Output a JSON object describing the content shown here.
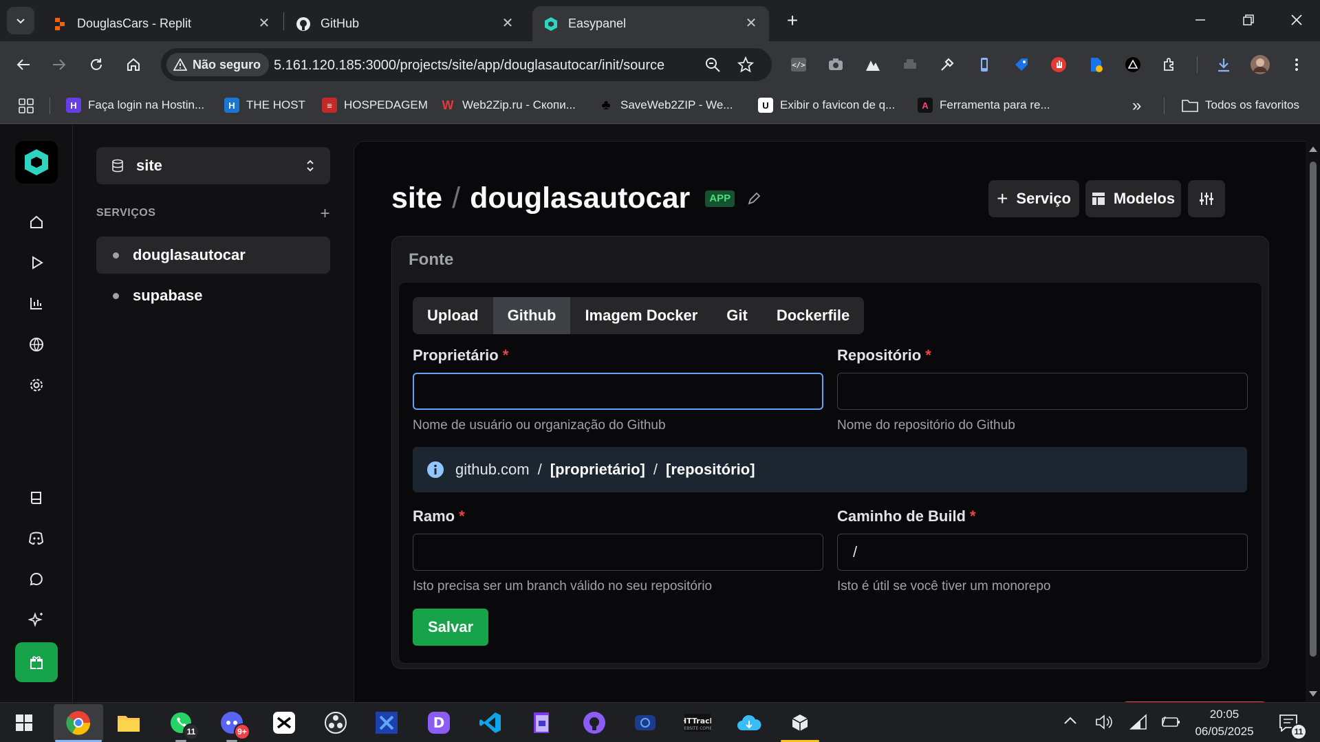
{
  "browser": {
    "tabs": [
      {
        "title": "DouglasCars - Replit",
        "active": false
      },
      {
        "title": "GitHub",
        "active": false
      },
      {
        "title": "Easypanel",
        "active": true
      }
    ],
    "security_label": "Não seguro",
    "url": "5.161.120.185:3000/projects/site/app/douglasautocar/init/source",
    "bookmarks": [
      {
        "label": "Faça login na Hostin...",
        "icon": "hostinger-icon"
      },
      {
        "label": "THE HOST",
        "icon": "the-host-icon"
      },
      {
        "label": "HOSPEDAGEM",
        "icon": "hospedagem-icon"
      },
      {
        "label": "Web2Zip.ru - Скопи...",
        "icon": "web2zip-icon"
      },
      {
        "label": "SaveWeb2ZIP - We...",
        "icon": "saveweb2zip-icon"
      },
      {
        "label": "Exibir o favicon de q...",
        "icon": "favicon-viewer-icon"
      },
      {
        "label": "Ferramenta para re...",
        "icon": "ferramenta-icon"
      }
    ],
    "all_bookmarks_label": "Todos os favoritos"
  },
  "sidebar": {
    "project": "site",
    "services_heading": "SERVIÇOS",
    "services": [
      {
        "label": "douglasautocar",
        "active": true
      },
      {
        "label": "supabase",
        "active": false
      }
    ]
  },
  "header": {
    "project": "site",
    "separator": "/",
    "service": "douglasautocar",
    "badge": "APP",
    "buttons": {
      "service": "Serviço",
      "templates": "Modelos"
    }
  },
  "source": {
    "title": "Fonte",
    "tabs": [
      "Upload",
      "Github",
      "Imagem Docker",
      "Git",
      "Dockerfile"
    ],
    "selected_tab": "Github",
    "owner": {
      "label": "Proprietário",
      "required": "*",
      "value": "",
      "hint": "Nome de usuário ou organização do Github"
    },
    "repo": {
      "label": "Repositório",
      "required": "*",
      "value": "",
      "hint": "Nome do repositório do Github"
    },
    "info": {
      "domain": "github.com",
      "sep": "/",
      "owner": "[proprietário]",
      "repo": "[repositório]"
    },
    "branch": {
      "label": "Ramo",
      "required": "*",
      "value": "",
      "hint": "Isto precisa ser um branch válido no seu repositório"
    },
    "build_path": {
      "label": "Caminho de Build",
      "required": "*",
      "value": "/",
      "hint": "Isto é útil se você tiver um monorepo"
    },
    "save_label": "Salvar"
  },
  "taskbar": {
    "whatsapp_badge": "11",
    "discord_badge": "9+",
    "time": "20:05",
    "date": "06/05/2025",
    "notification_badge": "11"
  },
  "colors": {
    "accent_green": "#16a34a",
    "focus_blue": "#60a5fa",
    "required_red": "#ef4444",
    "brand_teal": "#2dd4bf"
  }
}
